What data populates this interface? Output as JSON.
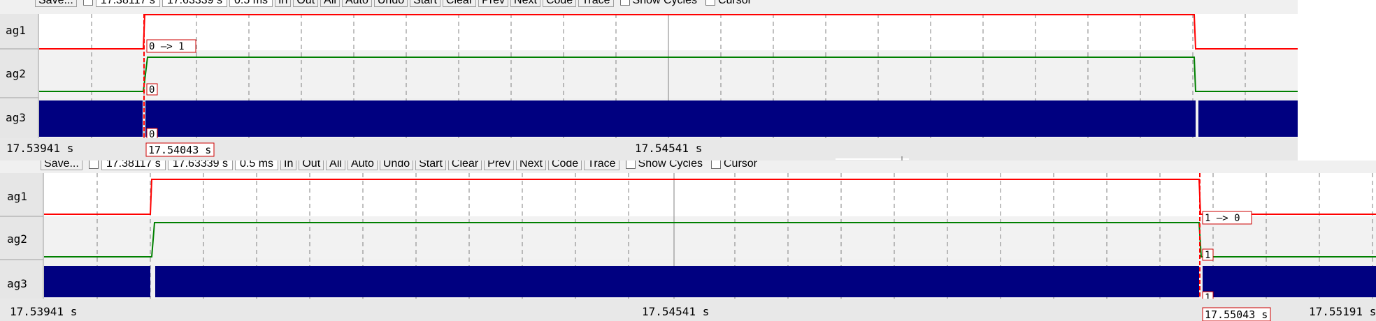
{
  "toolbar": {
    "save_label": "Save...",
    "time1": "17.38117 s",
    "time2": "17.63339 s",
    "div": "0.5 ms",
    "in_label": "In",
    "out_label": "Out",
    "all_label": "All",
    "auto_label": "Auto",
    "undo_label": "Undo",
    "start_label": "Start",
    "clear_label": "Clear",
    "prev_label": "Prev",
    "next_label": "Next",
    "code_label": "Code",
    "trace_label": "Trace",
    "show_cycles_label": "Show Cycles",
    "cursor_label": "Cursor"
  },
  "signals": [
    {
      "label": "ag1",
      "color": "#ff0000"
    },
    {
      "label": "ag2",
      "color": "#008000"
    },
    {
      "label": "ag3",
      "color": "#000080"
    }
  ],
  "panels": [
    {
      "time_left": "17.53941 s",
      "time_mid": "17.54541 s",
      "cursor_time": "17.54043 s",
      "cursor_annotation": "0 —> 1",
      "ag2_value": "0",
      "ag3_value": "0"
    },
    {
      "time_left": "17.53941 s",
      "time_mid": "17.54541 s",
      "time_right": "17.55191 s",
      "cursor_time": "17.55043 s",
      "cursor_annotation": "1 —> 0",
      "ag2_value": "1",
      "ag3_value": "1"
    }
  ],
  "colors": {
    "grid": "#808080",
    "cursor": "#ff0000",
    "bus": "#000080",
    "panel_bg": "#f0f0f0"
  }
}
